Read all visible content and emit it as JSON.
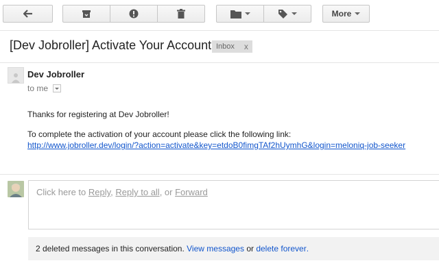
{
  "toolbar": {
    "back_icon": "arrow-left-icon",
    "archive_icon": "archive-icon",
    "spam_icon": "report-spam-icon",
    "delete_icon": "trash-icon",
    "move_icon": "folder-icon",
    "labels_icon": "tag-icon",
    "more_label": "More"
  },
  "email": {
    "subject": "[Dev Jobroller] Activate Your Account",
    "label": "Inbox",
    "label_remove": "x",
    "sender": "Dev Jobroller",
    "recipient": "to me",
    "body_line1": "Thanks for registering at Dev Jobroller!",
    "body_line2": "To complete the activation of your account please click the following link:",
    "activation_link": "http://www.jobroller.dev/login/?action=activate&key=etdoB0fimgTAf2hUymhG&login=meloniq-job-seeker"
  },
  "reply": {
    "prompt_prefix": "Click here to ",
    "reply": "Reply",
    "sep1": ", ",
    "reply_all": "Reply to all",
    "sep2": ", or ",
    "forward": "Forward"
  },
  "conversation": {
    "deleted_text": "2 deleted messages in this conversation.",
    "view_messages": "View messages",
    "or_text": "or",
    "delete_forever": "delete forever",
    "period": "."
  },
  "colors": {
    "link": "#1155cc",
    "label_bg": "#dddddd",
    "muted": "#999999"
  }
}
